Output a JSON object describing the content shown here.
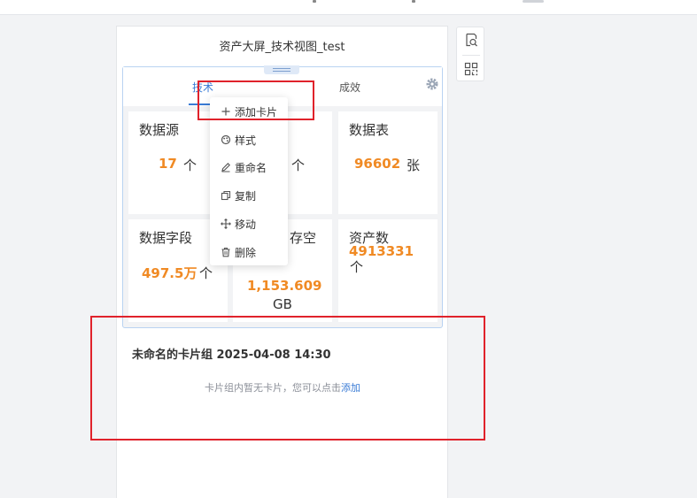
{
  "panel": {
    "title": "资产大屏_技术视图_test"
  },
  "tabs": [
    {
      "label": "技术"
    },
    {
      "label": "成效"
    }
  ],
  "cards": [
    {
      "title": "数据源",
      "value": "17",
      "unit": "个"
    },
    {
      "title": "",
      "value": "",
      "unit": "个"
    },
    {
      "title": "数据表",
      "value": "96602",
      "unit": "张"
    },
    {
      "title": "数据字段",
      "value": "497.5万",
      "unit": "个"
    },
    {
      "title": "存空",
      "value": "1,153.609",
      "unit": "GB"
    },
    {
      "title": "资产数",
      "value": "4913331",
      "unit": "个"
    }
  ],
  "context_menu": {
    "items": [
      {
        "label": "添加卡片",
        "icon": "plus-icon"
      },
      {
        "label": "样式",
        "icon": "palette-icon"
      },
      {
        "label": "重命名",
        "icon": "edit-icon"
      },
      {
        "label": "复制",
        "icon": "copy-icon"
      },
      {
        "label": "移动",
        "icon": "move-icon"
      },
      {
        "label": "删除",
        "icon": "trash-icon"
      }
    ]
  },
  "group2": {
    "title": "未命名的卡片组 2025-04-08 14:30",
    "hint_text": "卡片组内暂无卡片，您可以点击",
    "hint_link": "添加"
  },
  "colors": {
    "accent": "#3a7bd5",
    "value_orange": "#f08a24",
    "highlight_red": "#e0222b"
  }
}
